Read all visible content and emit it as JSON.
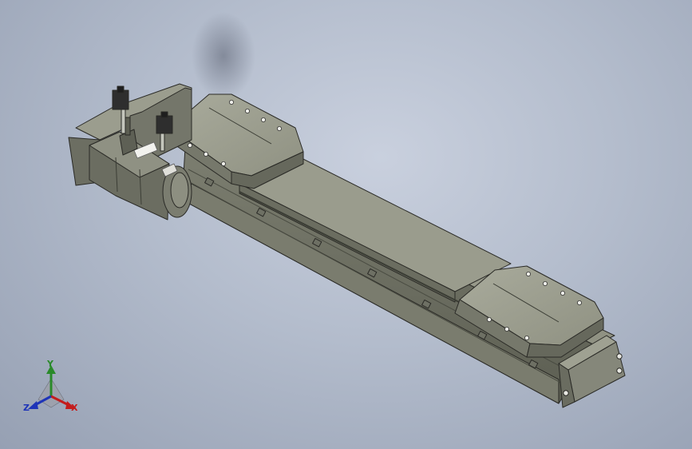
{
  "viewport": {
    "background_top": "#c9d0de",
    "background_bottom": "#96a0b3"
  },
  "model": {
    "body_color": "#8e9080",
    "face_light": "#a6a898",
    "face_dark": "#5d5f52",
    "edge_color": "#2a2a26",
    "connector_color": "#2e2e2e"
  },
  "triad": {
    "x_label": "X",
    "y_label": "Y",
    "z_label": "Z",
    "x_color": "#c41c1c",
    "y_color": "#2a8a2a",
    "z_color": "#1e34b8"
  }
}
